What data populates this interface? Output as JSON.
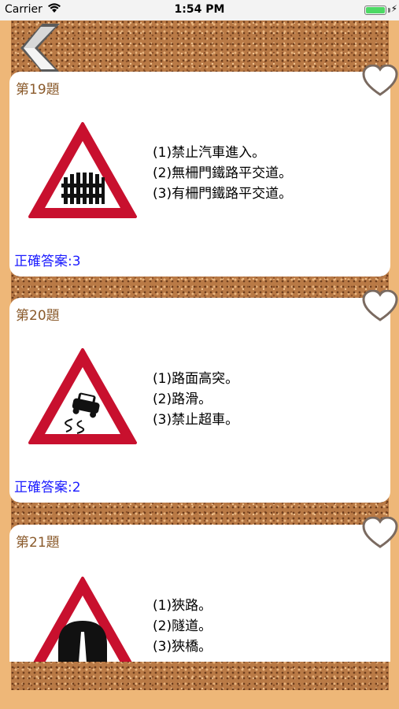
{
  "status_bar": {
    "carrier": "Carrier",
    "time": "1:54 PM"
  },
  "questions": [
    {
      "title": "第19題",
      "sign_icon": "railway-crossing-with-gate-sign",
      "options": [
        "(1)禁止汽車進入。",
        "(2)無柵門鐵路平交道。",
        "(3)有柵門鐵路平交道。"
      ],
      "answer": "正確答案:3"
    },
    {
      "title": "第20題",
      "sign_icon": "slippery-road-sign",
      "options": [
        "(1)路面高突。",
        "(2)路滑。",
        "(3)禁止超車。"
      ],
      "answer": "正確答案:2"
    },
    {
      "title": "第21題",
      "sign_icon": "tunnel-sign",
      "options": [
        "(1)狹路。",
        "(2)隧道。",
        "(3)狹橋。"
      ],
      "answer": ""
    }
  ],
  "colors": {
    "frame": "#eeb778",
    "answer_text": "#1c1cff",
    "title_text": "#8a5a2b",
    "sign_red": "#c8102e"
  }
}
